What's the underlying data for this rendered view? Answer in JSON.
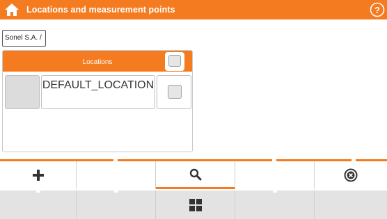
{
  "app": {
    "title": "Locations and measurement points",
    "icons": {
      "home": "home-icon",
      "help": "help-icon"
    },
    "accent_color": "#f47b20"
  },
  "breadcrumb": {
    "text": "Sonel S.A. /"
  },
  "locations_panel": {
    "header": "Locations",
    "header_checkbox_checked": false,
    "rows": [
      {
        "name": "DEFAULT_LOCATION",
        "checked": false
      }
    ]
  },
  "toolbar": {
    "buttons": [
      {
        "icon": "plus-icon"
      },
      {
        "icon": ""
      },
      {
        "icon": "search-icon",
        "active": true
      },
      {
        "icon": ""
      },
      {
        "icon": "close-circle-icon"
      }
    ]
  },
  "bottom_bar": {
    "buttons": [
      {
        "icon": ""
      },
      {
        "icon": ""
      },
      {
        "icon": "grid-icon"
      },
      {
        "icon": ""
      },
      {
        "icon": ""
      }
    ]
  }
}
